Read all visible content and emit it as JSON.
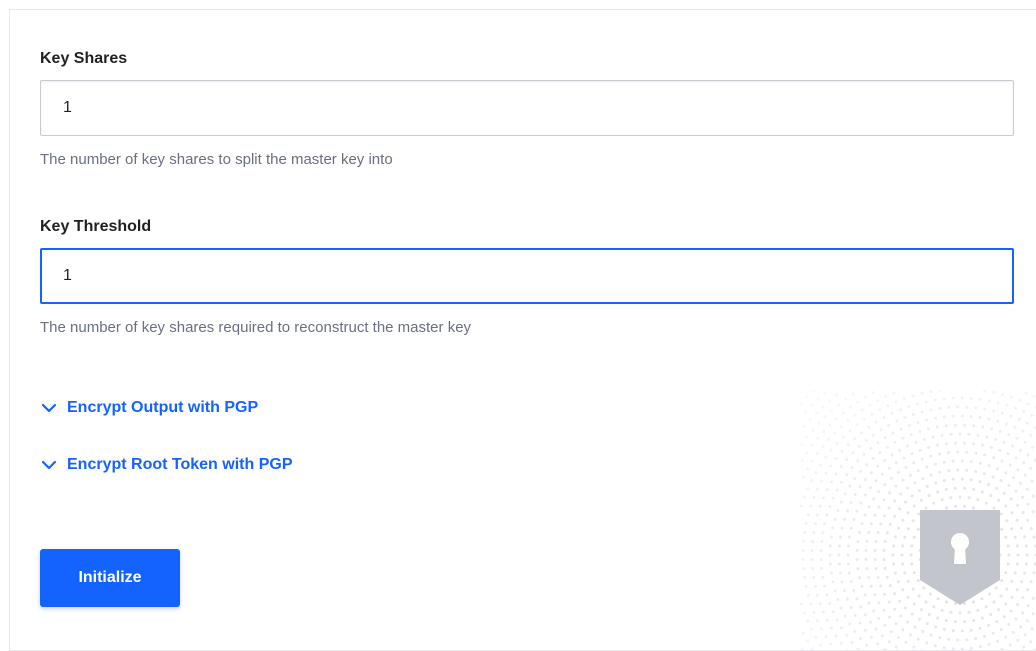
{
  "form": {
    "key_shares": {
      "label": "Key Shares",
      "value": "1",
      "help": "The number of key shares to split the master key into"
    },
    "key_threshold": {
      "label": "Key Threshold",
      "value": "1",
      "help": "The number of key shares required to reconstruct the master key"
    },
    "toggles": {
      "encrypt_output": "Encrypt Output with PGP",
      "encrypt_root_token": "Encrypt Root Token with PGP"
    },
    "submit_label": "Initialize"
  },
  "colors": {
    "accent": "#1563ff",
    "label": "#1f2124",
    "help": "#6a7080",
    "shield": "#c2c5cc"
  },
  "icons": {
    "toggle_icon": "chevron-down-icon",
    "decor_icon": "shield-keyhole-icon"
  }
}
